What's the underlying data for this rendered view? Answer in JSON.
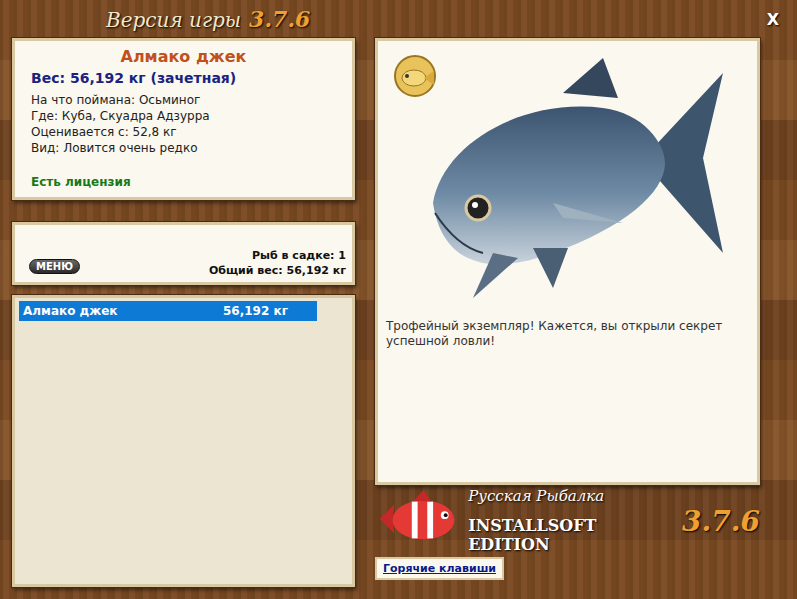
{
  "window": {
    "title_prefix": "Версия игры",
    "version": "3.7.6",
    "close": "X"
  },
  "fish": {
    "name": "Алмако джек",
    "weight": "Вес: 56,192 кг (зачетная)",
    "details": [
      "На что поймана: Осьминог",
      "Где: Куба, Скуадра Адзурра",
      "Оценивается с: 52,8 кг",
      "Вид: Ловится очень редко"
    ],
    "license": "Есть лицензия",
    "message": "Трофейный экземпляр! Кажется, вы открыли секрет успешной ловли!"
  },
  "menu_button": "МЕНЮ",
  "keepnet": {
    "count": "Рыб в садке: 1",
    "total": "Общий вес: 56,192 кг"
  },
  "catch_list": [
    {
      "name": "Алмако джек",
      "weight": "56,192 кг",
      "selected": true
    }
  ],
  "logo": {
    "title": "Русская Рыбалка",
    "edition": "INSTALLSOFT EDITION",
    "version": "3.7.6"
  },
  "hotkeys_button": "Горячие клавиши"
}
